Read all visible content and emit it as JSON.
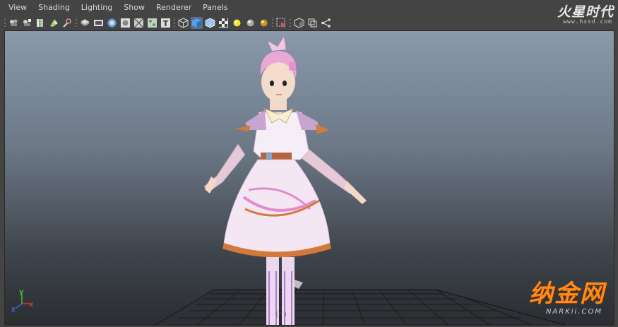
{
  "menubar": {
    "items": [
      "View",
      "Shading",
      "Lighting",
      "Show",
      "Renderer",
      "Panels"
    ]
  },
  "toolbar": {
    "groups": [
      [
        "camera-select-icon",
        "camera-attributes-icon",
        "bookmarks-icon",
        "image-plane-icon",
        "two-d-pan-zoom-icon"
      ],
      [
        "grid-icon",
        "film-gate-icon",
        "resolution-gate-icon",
        "gate-mask-icon",
        "field-chart-icon",
        "safe-action-icon",
        "safe-title-icon"
      ],
      [
        "wireframe-icon",
        "smooth-shade-icon",
        "wireframe-on-shaded-icon",
        "textured-icon",
        "use-all-lights-icon",
        "shadows-icon",
        "ambient-occlusion-icon"
      ],
      [
        "isolate-select-icon"
      ],
      [
        "xray-icon",
        "xray-joints-icon",
        "backface-culling-icon"
      ]
    ]
  },
  "logo": {
    "text": "火星时代",
    "url": "www.hxsd.com"
  },
  "viewport": {
    "axis_labels": {
      "x": "x",
      "y": "y",
      "z": "z"
    },
    "hud_text": "(          )"
  },
  "watermark": {
    "text": "纳金网",
    "url": "NARKii.COM"
  },
  "colors": {
    "background": "#444444",
    "menu_text": "#d8d8d8",
    "viewport_top": "#8a99ab",
    "viewport_bottom": "#2a2d31",
    "axis_x": "#d23a3a",
    "axis_y": "#3ac23a",
    "axis_z": "#3a6ad2",
    "watermark": "#ff8a1a"
  }
}
